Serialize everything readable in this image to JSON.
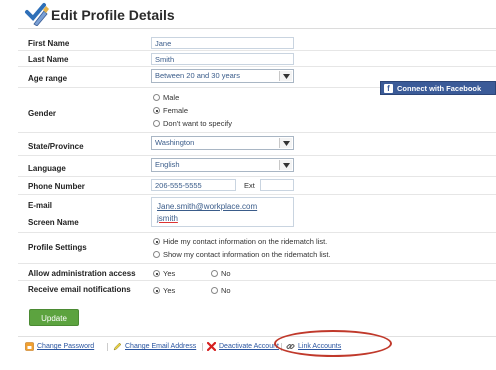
{
  "header": {
    "title": "Edit Profile Details"
  },
  "fields": {
    "first_name": {
      "label": "First Name",
      "value": "Jane"
    },
    "last_name": {
      "label": "Last Name",
      "value": "Smith"
    },
    "age_range": {
      "label": "Age range",
      "value": "Between 20 and 30 years"
    },
    "gender": {
      "label": "Gender",
      "options": [
        "Male",
        "Female",
        "Don't want to specify"
      ],
      "selected": "Female"
    },
    "state": {
      "label": "State/Province",
      "value": "Washington"
    },
    "language": {
      "label": "Language",
      "value": "English"
    },
    "phone": {
      "label": "Phone Number",
      "value": "206-555-5555",
      "ext_label": "Ext"
    },
    "email": {
      "label": "E-mail",
      "value": "Jane.smith@workplace.com"
    },
    "screen_name": {
      "label": "Screen Name",
      "value": "jsmith"
    },
    "profile_settings": {
      "label": "Profile Settings",
      "options": [
        "Hide my contact information on the ridematch list.",
        "Show my contact information on the ridematch list."
      ],
      "selected": "Hide my contact information on the ridematch list."
    },
    "admin_access": {
      "label": "Allow administration access",
      "yes": "Yes",
      "no": "No",
      "selected": "Yes"
    },
    "email_notifications": {
      "label": "Receive email notifications",
      "yes": "Yes",
      "no": "No",
      "selected": "Yes"
    }
  },
  "facebook_button": {
    "label": "Connect with Facebook"
  },
  "update_button": {
    "label": "Update"
  },
  "footer_links": {
    "change_password": "Change Password",
    "change_email": "Change Email Address",
    "deactivate": "Deactivate Account",
    "link_accounts": "Link Accounts"
  },
  "colors": {
    "facebook": "#3b5b98",
    "update": "#5ca33f",
    "link": "#2a55a0",
    "highlight_circle": "#c0392b"
  }
}
